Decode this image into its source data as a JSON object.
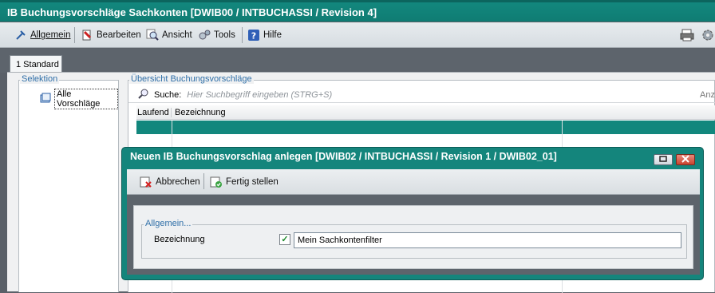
{
  "window": {
    "title": "IB Buchungsvorschläge Sachkonten [DWIB00 / INTBUCHASSI / Revision 4]"
  },
  "menu": {
    "allgemein": "Allgemein",
    "bearbeiten": "Bearbeiten",
    "ansicht": "Ansicht",
    "tools": "Tools",
    "hilfe": "Hilfe"
  },
  "tabs": [
    {
      "label": "1 Standard"
    }
  ],
  "selektion": {
    "label": "Selektion",
    "items": [
      {
        "label": "Alle Vorschläge"
      }
    ]
  },
  "overview": {
    "label": "Übersicht Buchungsvorschläge",
    "search": {
      "label": "Suche:",
      "placeholder": "Hier Suchbegriff eingeben (STRG+S)",
      "right_label": "Anz"
    },
    "columns": [
      "Laufend",
      "Bezeichnung"
    ]
  },
  "dialog": {
    "title": "Neuen IB Buchungsvorschlag anlegen [DWIB02 / INTBUCHASSI / Revision 1 / DWIB02_01]",
    "toolbar": {
      "abbrechen": "Abbrechen",
      "fertig": "Fertig stellen"
    },
    "group_label": "Allgemein...",
    "field_label": "Bezeichnung",
    "field_value": "Mein Sachkontenfilter",
    "checkbox_mark": "✓"
  },
  "colors": {
    "titlebar": "#13897f",
    "accent_text": "#2f6fa8",
    "selected_row": "#12877d",
    "dark_band": "#5d646c"
  },
  "icons": [
    "pin-icon",
    "edit-icon",
    "magnifier-icon",
    "gears-icon",
    "help-icon",
    "printer-icon",
    "settings-icon",
    "folder-icon",
    "search-icon",
    "cancel-icon",
    "finish-icon",
    "restore-icon",
    "close-icon"
  ]
}
